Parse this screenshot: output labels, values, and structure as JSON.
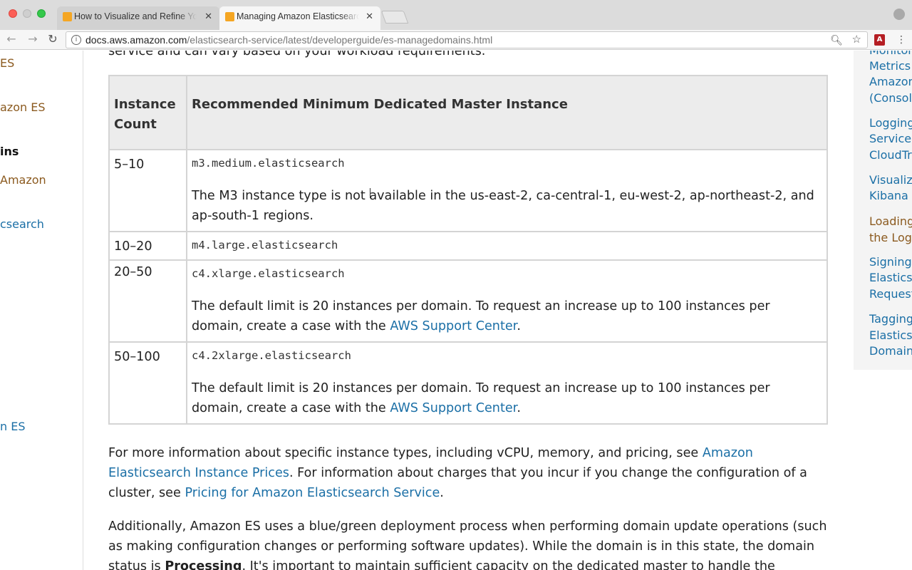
{
  "browser": {
    "tabs": [
      {
        "title": "How to Visualize and Refine Yo",
        "close": "✕"
      },
      {
        "title": "Managing Amazon Elasticsearc",
        "close": "✕"
      }
    ],
    "url_host": "docs.aws.amazon.com",
    "url_path": "/elasticsearch-service/latest/developerguide/es-managedomains.html"
  },
  "left_nav": {
    "items": [
      {
        "label": "ES",
        "style": "visited"
      },
      {
        "label": "azon ES",
        "style": "visited"
      },
      {
        "label": "ins",
        "style": "current"
      },
      {
        "label": "Amazon",
        "style": "visited"
      },
      {
        "label": "csearch",
        "style": "blue"
      },
      {
        "label": "n ES",
        "style": "blue"
      }
    ]
  },
  "content": {
    "prev_line": "service and can vary based on your workload requirements.",
    "table": {
      "headers": [
        "Instance Count",
        "Recommended Minimum Dedicated Master Instance"
      ],
      "rows": [
        {
          "count": "5–10",
          "instance": "m3.medium.elasticsearch",
          "note": "The M3 instance type is not available in the us-east-2, ca-central-1, eu-west-2, ap-northeast-2, and ap-south-1 regions."
        },
        {
          "count": "10–20",
          "instance": "m4.large.elasticsearch"
        },
        {
          "count": "20–50",
          "instance": "c4.xlarge.elasticsearch",
          "note_prefix": "The default limit is 20 instances per domain. To request an increase up to 100 instances per domain, create a case with the ",
          "note_link": "AWS Support Center",
          "note_suffix": "."
        },
        {
          "count": "50–100",
          "instance": "c4.2xlarge.elasticsearch",
          "note_prefix": "The default limit is 20 instances per domain. To request an increase up to 100 instances per domain, create a case with the ",
          "note_link": "AWS Support Center",
          "note_suffix": "."
        }
      ]
    },
    "para1": {
      "text1": "For more information about specific instance types, including vCPU, memory, and pricing, see ",
      "link1": "Amazon Elasticsearch Instance Prices",
      "text2": ". For information about charges that you incur if you change the configuration of a cluster, see ",
      "link2": "Pricing for Amazon Elasticsearch Service",
      "text3": "."
    },
    "para2": {
      "text1": "Additionally, Amazon ES uses a blue/green deployment process when performing domain update operations (such as making configuration changes or performing software updates). While the domain is in this state, the domain status is ",
      "bold": "Processing",
      "text2": ". It's important to maintain sufficient capacity on the dedicated master to handle the management"
    }
  },
  "right_nav": {
    "items": [
      "Monitor",
      "Metrics",
      "Amazon",
      "(Console",
      "Logging",
      "Service",
      "CloudTr",
      "Visualiz",
      "Kibana",
      "Loading",
      "the Logs",
      "Signing",
      "Elasticse",
      "Request",
      "Tagging",
      "Elasticse",
      "Domain"
    ]
  },
  "colors": {
    "link": "#1b6fa6",
    "visited": "#8b5a1f",
    "header_bg": "#ececec"
  }
}
